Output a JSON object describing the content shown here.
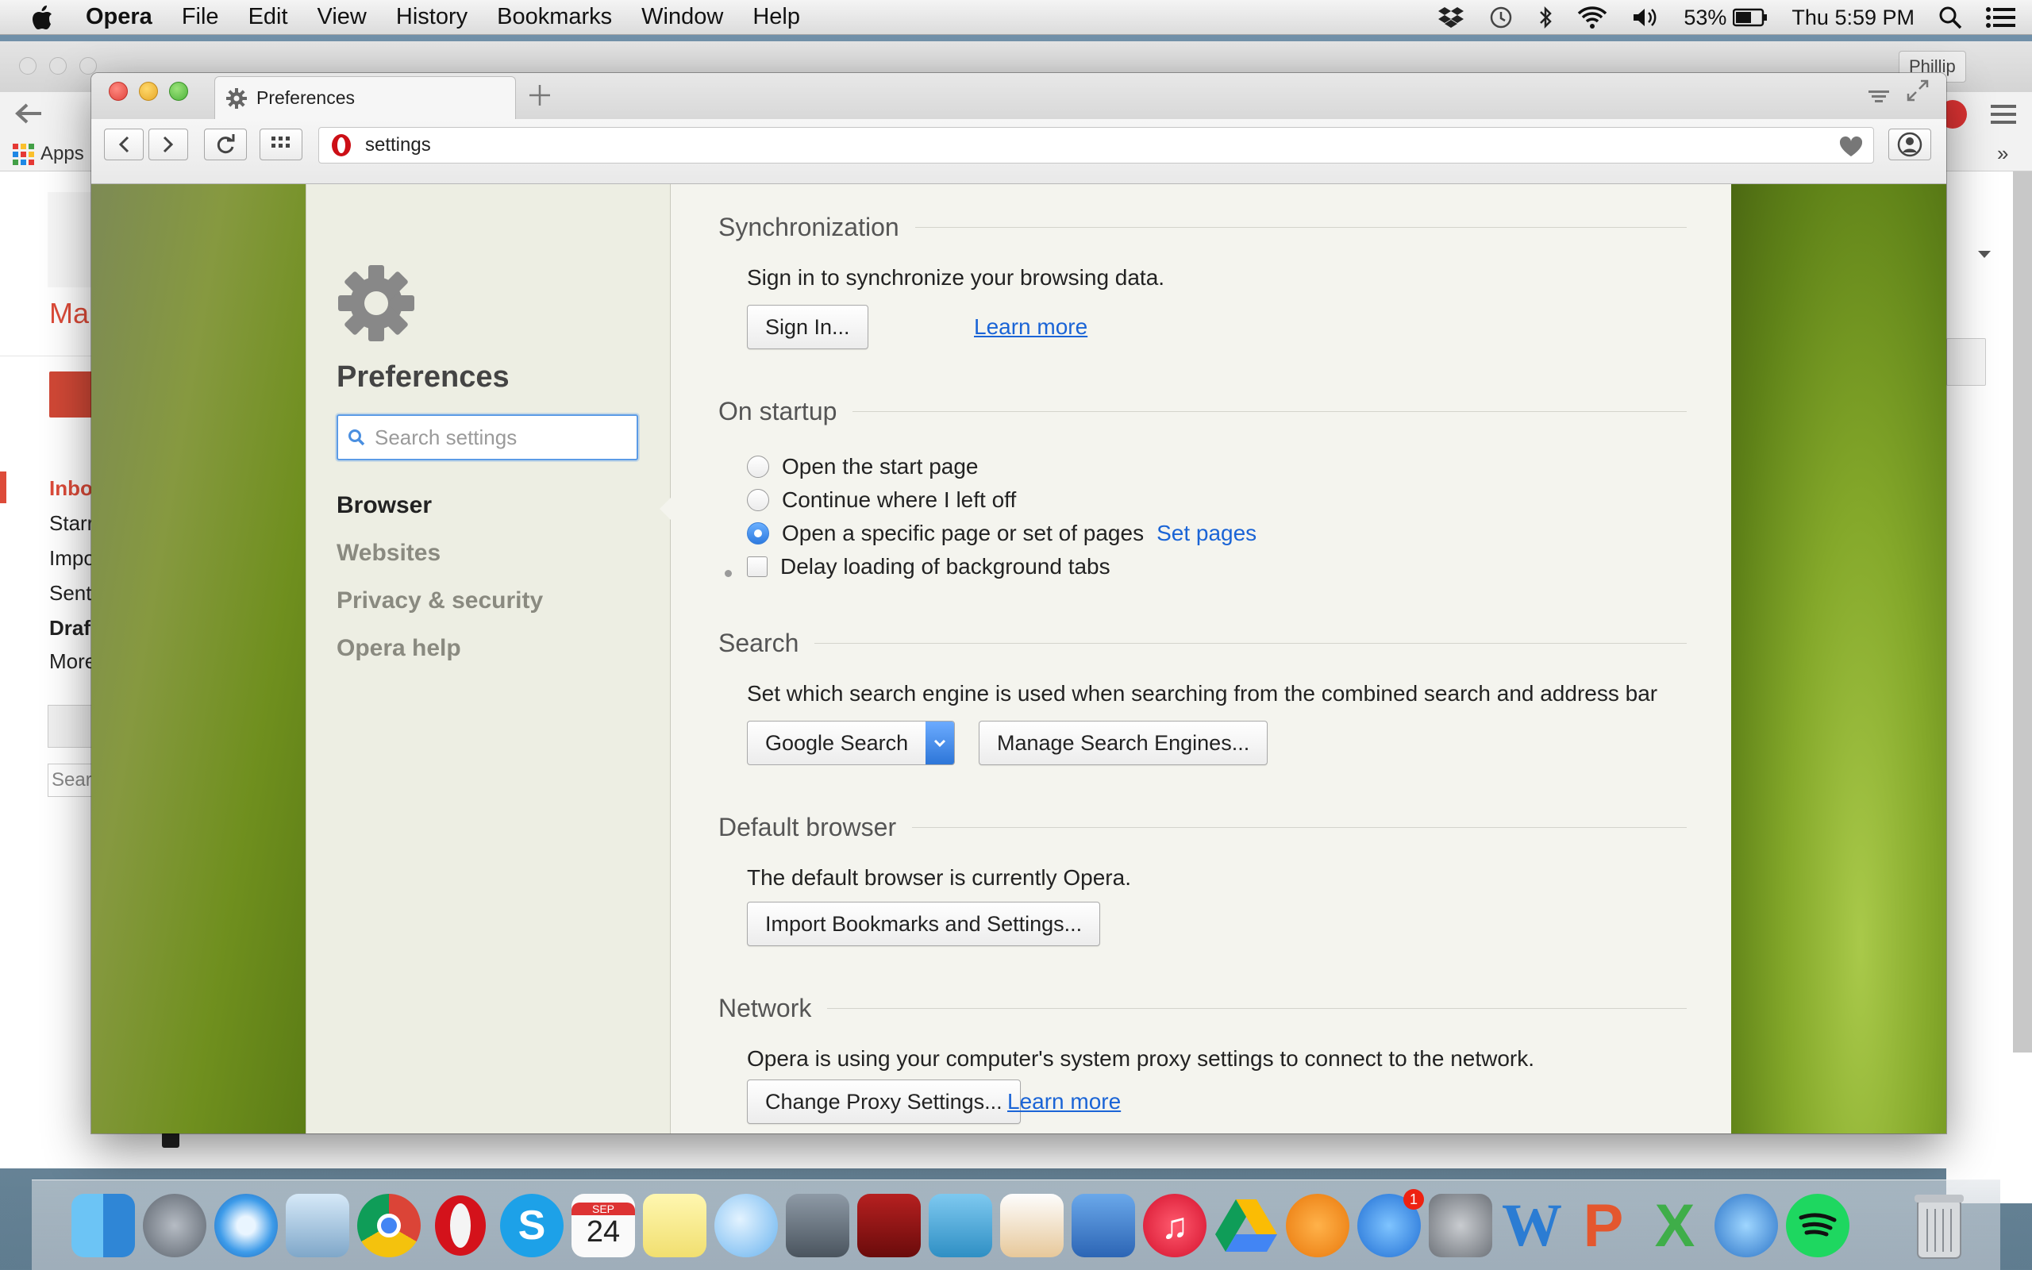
{
  "menubar": {
    "app": "Opera",
    "items": [
      "File",
      "Edit",
      "View",
      "History",
      "Bookmarks",
      "Window",
      "Help"
    ],
    "battery": "53%",
    "clock": "Thu 5:59 PM"
  },
  "bg_window": {
    "bookmark_apps": "Apps",
    "user_label": "Phillip",
    "header_text": "Ma",
    "labels": [
      "Inbo",
      "Starr",
      "Impo",
      "Sent",
      "Draf",
      "More"
    ],
    "search_placeholder": "Sear"
  },
  "opera": {
    "tab_title": "Preferences",
    "address": "settings",
    "sidebar": {
      "title": "Preferences",
      "search_placeholder": "Search settings",
      "nav": [
        "Browser",
        "Websites",
        "Privacy & security",
        "Opera help"
      ]
    },
    "sync": {
      "title": "Synchronization",
      "text": "Sign in to synchronize your browsing data.",
      "signin": "Sign In...",
      "learn": "Learn more"
    },
    "startup": {
      "title": "On startup",
      "options": [
        "Open the start page",
        "Continue where I left off",
        "Open a specific page or set of pages"
      ],
      "selected": 2,
      "set_pages": "Set pages",
      "delay": "Delay loading of background tabs"
    },
    "search": {
      "title": "Search",
      "text": "Set which search engine is used when searching from the combined search and address bar",
      "engine": "Google Search",
      "manage": "Manage Search Engines..."
    },
    "default_browser": {
      "title": "Default browser",
      "text": "The default browser is currently Opera.",
      "import": "Import Bookmarks and Settings..."
    },
    "network": {
      "title": "Network",
      "text": "Opera is using your computer's system proxy settings to connect to the network.",
      "proxy": "Change Proxy Settings...",
      "learn": "Learn more"
    }
  },
  "dock": {
    "apps": [
      "Finder",
      "Launchpad",
      "Safari",
      "Mail",
      "Chrome",
      "Opera",
      "Skype",
      "Calendar",
      "Stickies",
      "Messages",
      "FaceTime",
      "Photo Booth",
      "iPhoto",
      "Pages",
      "Keynote",
      "iTunes",
      "Google Drive",
      "iBooks",
      "App Store",
      "System Preferences",
      "Word",
      "PowerPoint",
      "Excel",
      "Downloads",
      "Spotify"
    ],
    "calendar_month": "SEP",
    "calendar_day": "24",
    "app_store_badge": "1"
  }
}
